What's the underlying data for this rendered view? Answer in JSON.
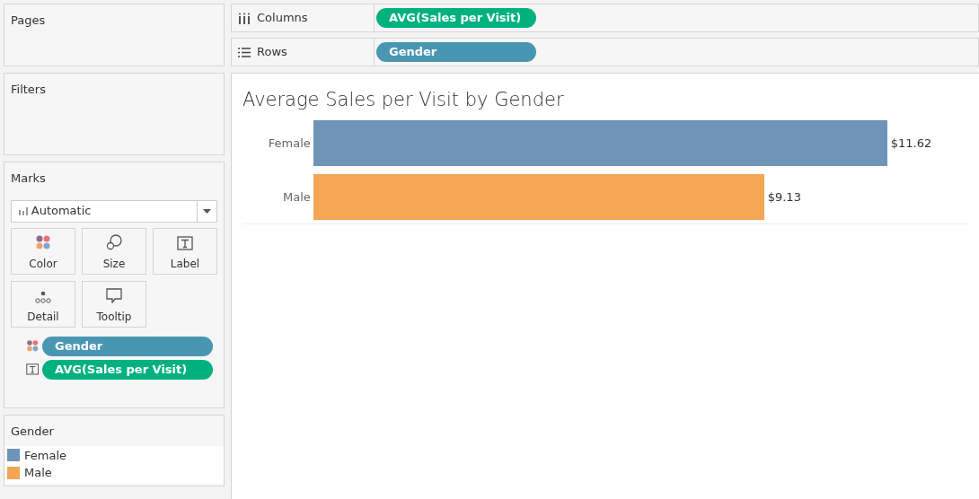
{
  "pages": {
    "title": "Pages"
  },
  "filters": {
    "title": "Filters"
  },
  "marks": {
    "title": "Marks",
    "mark_type": "Automatic",
    "cards": [
      {
        "label": "Color",
        "kind": "color"
      },
      {
        "label": "Size",
        "kind": "size"
      },
      {
        "label": "Label",
        "kind": "label"
      },
      {
        "label": "Detail",
        "kind": "detail"
      },
      {
        "label": "Tooltip",
        "kind": "tooltip"
      }
    ],
    "fields": [
      {
        "label": "Gender",
        "kind": "color",
        "color": "#4996b2"
      },
      {
        "label": "AVG(Sales per Visit)",
        "kind": "label",
        "color": "#00b180"
      }
    ]
  },
  "legend": {
    "title": "Gender",
    "items": [
      {
        "label": "Female",
        "color": "#6f94b8"
      },
      {
        "label": "Male",
        "color": "#f4a556"
      }
    ]
  },
  "shelves": [
    {
      "label": "Columns",
      "kind": "columns",
      "pill": {
        "label": "AVG(Sales per Visit)",
        "color": "#00b180"
      }
    },
    {
      "label": "Rows",
      "kind": "rows",
      "pill": {
        "label": "Gender",
        "color": "#4996b2"
      }
    }
  ],
  "view": {
    "chart_data": {
      "type": "bar",
      "title": "Average Sales per Visit by Gender",
      "orientation": "horizontal",
      "categories": [
        "Female",
        "Male"
      ],
      "values": [
        11.62,
        9.13
      ],
      "value_labels": [
        "$11.62",
        "$9.13"
      ]
    }
  }
}
